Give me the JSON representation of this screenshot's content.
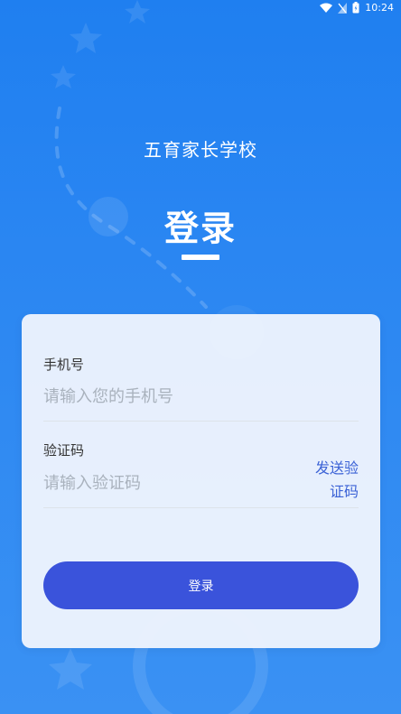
{
  "status": {
    "time": "10:24"
  },
  "header": {
    "subtitle": "五育家长学校",
    "title": "登录"
  },
  "form": {
    "phone_label": "手机号",
    "phone_placeholder": "请输入您的手机号",
    "code_label": "验证码",
    "code_placeholder": "请输入验证码",
    "send_code": "发送验证码",
    "submit": "登录"
  },
  "colors": {
    "accent": "#3a53db",
    "link": "#3b62d6",
    "background": "#2a86f2"
  },
  "icons": [
    "wifi-icon",
    "no-signal-icon",
    "battery-icon"
  ]
}
